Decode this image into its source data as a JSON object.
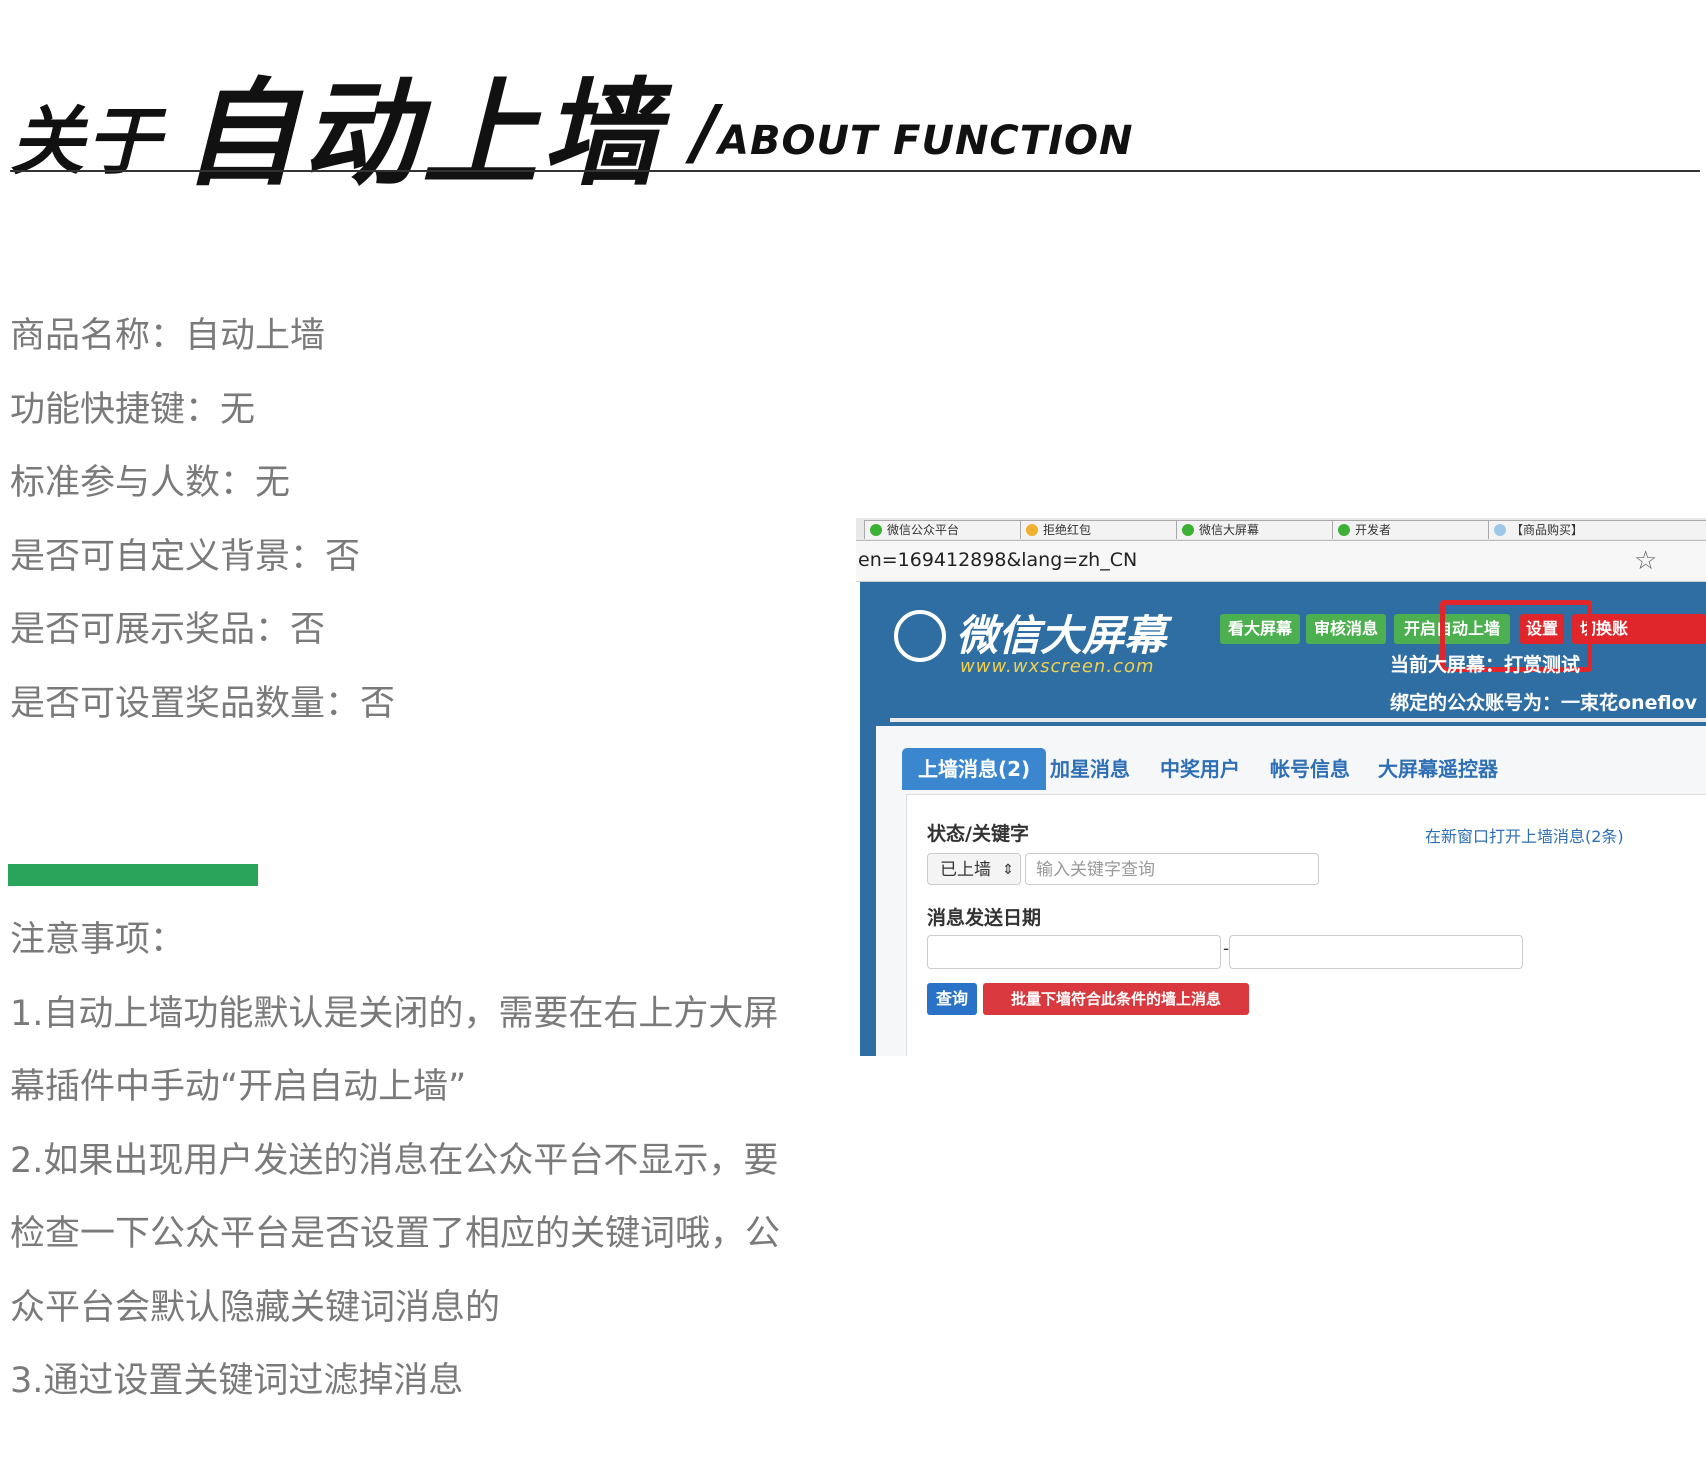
{
  "header": {
    "title_part1": "关于",
    "title_part2": "自动上墙",
    "slash": "/",
    "subtitle_en": "ABOUT FUNCTION"
  },
  "info_lines": [
    "商品名称：自动上墙",
    "功能快捷键：无",
    "标准参与人数：无",
    "是否可自定义背景：否",
    "是否可展示奖品：否",
    "是否可设置奖品数量：否"
  ],
  "notes": {
    "title": "注意事项：",
    "lines": [
      "1.自动上墙功能默认是关闭的，需要在右上方大屏",
      "幕插件中手动“开启自动上墙”",
      "2.如果出现用户发送的消息在公众平台不显示，要",
      "检查一下公众平台是否设置了相应的关键词哦，公",
      "众平台会默认隐藏关键词消息的",
      "3.通过设置关键词过滤掉消息"
    ]
  },
  "screenshot": {
    "tabs": [
      "微信公众平台",
      "拒绝红包",
      "微信大屏幕",
      "开发者",
      "【商品购买】"
    ],
    "tab_close": "×",
    "address": "en=169412898&lang=zh_CN",
    "star_icon": "☆",
    "logo_title": "微信大屏幕",
    "logo_url": "www.wxscreen.com",
    "nav_buttons": [
      "看大屏幕",
      "审核消息",
      "开启自动上墙",
      "设置",
      "切换账"
    ],
    "current_screen": "当前大屏幕：打赏测试",
    "bound_account": "绑定的公众账号为：一束花oneflov",
    "panel_tabs": [
      "上墙消息(2)",
      "加星消息",
      "中奖用户",
      "帐号信息",
      "大屏幕遥控器"
    ],
    "status_label": "状态/关键字",
    "open_link": "在新窗口打开上墙消息(2条)",
    "select_value": "已上墙",
    "select_arrow": "⇕",
    "keyword_placeholder": "输入关键字查询",
    "date_label": "消息发送日期",
    "date_sep": "-",
    "query_button": "查询",
    "batch_button": "批量下墙符合此条件的墙上消息"
  },
  "colors": {
    "green_bar": "#2aa45a",
    "app_blue": "#2f6ea3",
    "nav_green": "#4caf50",
    "nav_red": "#e0262a",
    "highlight": "#e0262a"
  }
}
